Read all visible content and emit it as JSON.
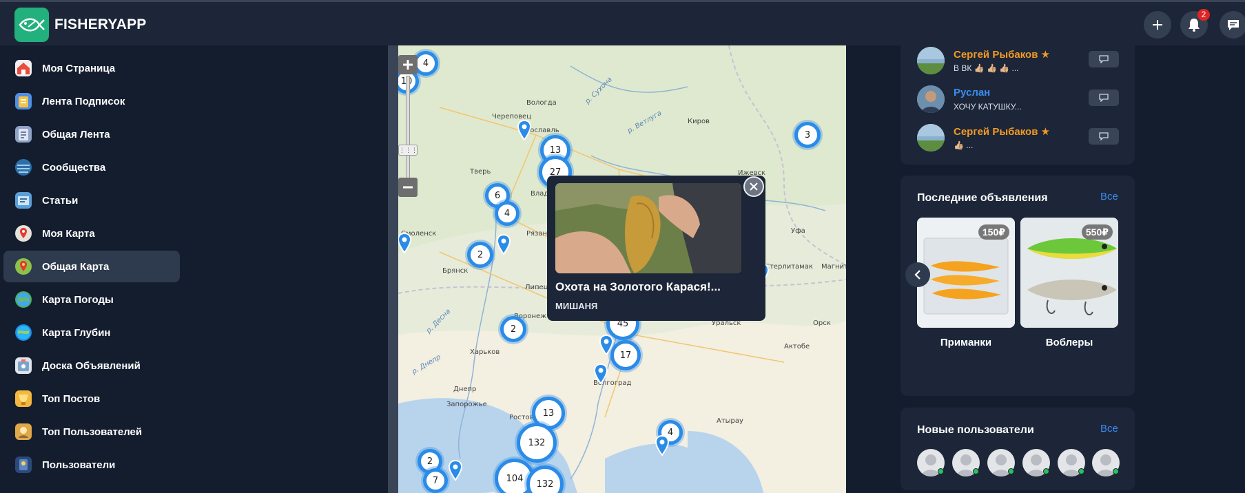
{
  "app": {
    "brand": "FISHERYAPP"
  },
  "header": {
    "notifications_count": "2"
  },
  "sidebar": {
    "items": [
      {
        "label": "Моя Страница",
        "icon": "home-icon"
      },
      {
        "label": "Лента Подписок",
        "icon": "subscriptions-icon"
      },
      {
        "label": "Общая Лента",
        "icon": "feed-icon"
      },
      {
        "label": "Сообщества",
        "icon": "communities-icon"
      },
      {
        "label": "Статьи",
        "icon": "articles-icon"
      },
      {
        "label": "Моя Карта",
        "icon": "my-map-icon"
      },
      {
        "label": "Общая Карта",
        "icon": "global-map-icon",
        "active": true
      },
      {
        "label": "Карта Погоды",
        "icon": "weather-map-icon"
      },
      {
        "label": "Карта Глубин",
        "icon": "depth-map-icon"
      },
      {
        "label": "Доска Объявлений",
        "icon": "ads-board-icon"
      },
      {
        "label": "Топ Постов",
        "icon": "top-posts-icon"
      },
      {
        "label": "Топ Пользователей",
        "icon": "top-users-icon"
      },
      {
        "label": "Пользователи",
        "icon": "users-icon"
      }
    ]
  },
  "map": {
    "place_labels": [
      "Вологда",
      "Череповец",
      "Киров",
      "Ижевск",
      "Тверь",
      "Уфа",
      "Рязань",
      "Брянск",
      "Липецк",
      "Воронеж",
      "Харьков",
      "Днепр",
      "Запорожье",
      "Ростов",
      "Волгоград",
      "Уральск",
      "Актобе",
      "Атырау",
      "Орск",
      "Магнитогорск",
      "Ярославль",
      "Смоленск",
      "Владимир",
      "Стерлитамак"
    ],
    "river_labels": [
      "р. Сухона",
      "р. Ветлуга",
      "р. Днепр",
      "р. Десна"
    ],
    "clusters": [
      "4",
      "10",
      "3",
      "6",
      "4",
      "2",
      "2",
      "13",
      "27",
      "45",
      "17",
      "13",
      "132",
      "104",
      "132",
      "2",
      "7",
      "4"
    ],
    "popup": {
      "title": "Охота на Золотого Карася!...",
      "author": "МИШАНЯ"
    }
  },
  "messages": [
    {
      "name": "Сергей Рыбаков",
      "text": "В ВК 👍🏼 👍🏼 👍🏼 ...",
      "star": true,
      "name_color": "#f39a24"
    },
    {
      "name": "Руслан",
      "text": "ХОЧУ КАТУШКУ...",
      "star": false,
      "name_color": "#3b8cf0"
    },
    {
      "name": "Сергей Рыбаков",
      "text": "👍🏼 ...",
      "star": true,
      "name_color": "#f39a24"
    }
  ],
  "ads": {
    "title": "Последние объявления",
    "all_link": "Все",
    "items": [
      {
        "price": "150₽",
        "label": "Приманки"
      },
      {
        "price": "550₽",
        "label": "Воблеры"
      }
    ]
  },
  "new_users": {
    "title": "Новые пользователи",
    "all_link": "Все",
    "count": 6
  }
}
